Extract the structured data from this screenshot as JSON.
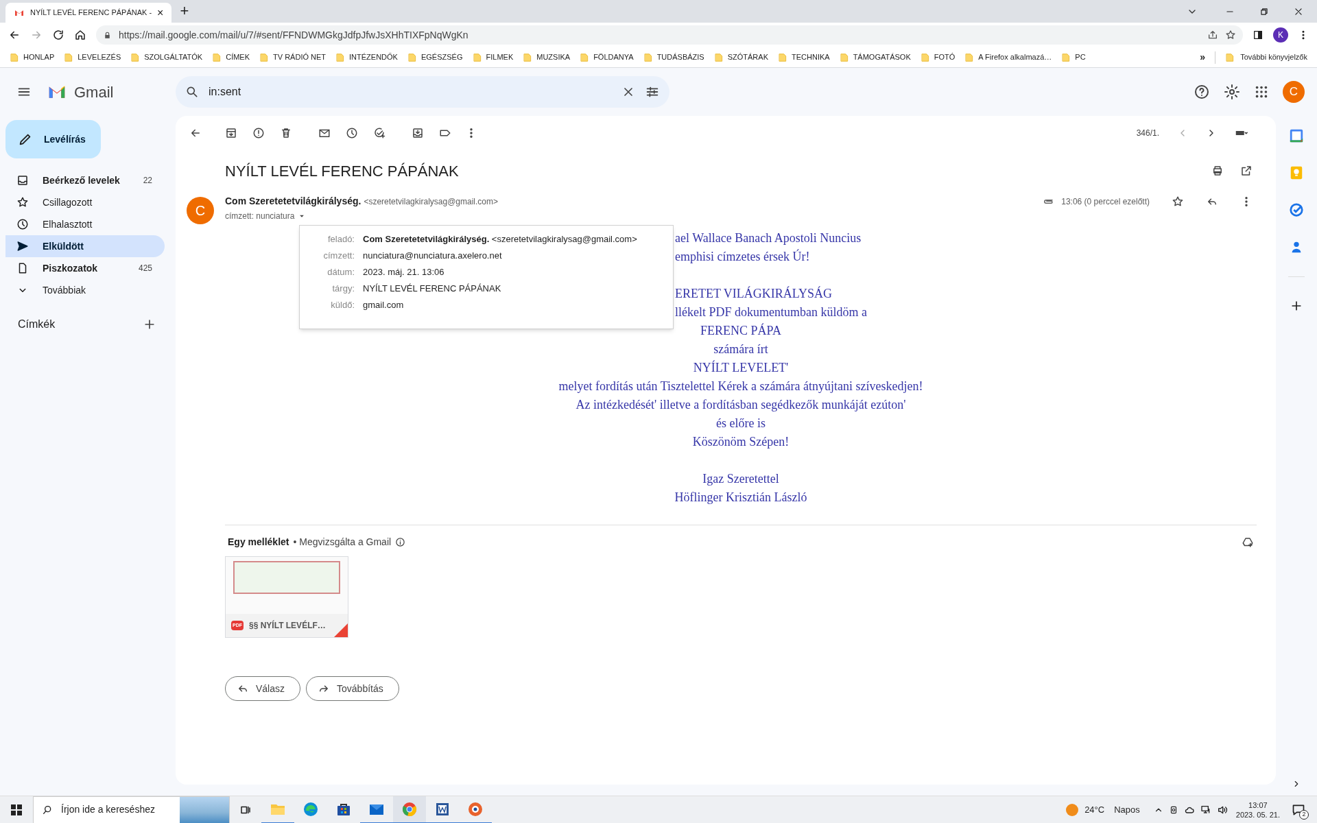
{
  "browser": {
    "tab": {
      "title": "NYÍLT LEVÉL FERENC PÁPÁNAK -",
      "close": "×"
    },
    "new_tab": "+",
    "url": "https://mail.google.com/mail/u/7/#sent/FFNDWMGkgJdfpJfwJsXHhTIXFpNqWgKn",
    "profile": "K",
    "bookmarks": [
      "HONLAP",
      "LEVELEZÉS",
      "SZOLGÁLTATÓK",
      "CÍMEK",
      "TV RÁDIÓ NET",
      "INTÉZENDŐK",
      "EGÉSZSÉG",
      "FILMEK",
      "MUZSIKA",
      "FÖLDANYA",
      "TUDÁSBÁZIS",
      "SZÓTÁRAK",
      "TECHNIKA",
      "TÁMOGATÁSOK",
      "FOTÓ",
      "A Firefox alkalmazá…",
      "PC"
    ],
    "more_bookmarks": "»",
    "other_bookmarks": "További könyvjelzők"
  },
  "gmail": {
    "app": "Gmail",
    "search": {
      "value": "in:sent"
    },
    "avatar": "C",
    "compose": "Levélírás",
    "folders": [
      {
        "kind": "inbox",
        "label": "Beérkező levelek",
        "count": "22",
        "unread": true,
        "selected": false
      },
      {
        "kind": "starred",
        "label": "Csillagozott",
        "unread": false,
        "selected": false
      },
      {
        "kind": "snoozed",
        "label": "Elhalasztott",
        "unread": false,
        "selected": false
      },
      {
        "kind": "sent",
        "label": "Elküldött",
        "unread": true,
        "selected": true
      },
      {
        "kind": "drafts",
        "label": "Piszkozatok",
        "count": "425",
        "unread": true,
        "selected": false
      },
      {
        "kind": "more",
        "label": "Továbbiak",
        "unread": false,
        "selected": false
      }
    ],
    "labels_heading": "Címkék",
    "counter": "346/1.",
    "message": {
      "subject": "NYÍLT LEVÉL FERENC PÁPÁNAK",
      "avatar": "C",
      "sender_name": "Com Szeretetetvilágkirálység.",
      "sender_email": "<szeretetvilagkiralysag@gmail.com>",
      "recipient": "címzett: nunciatura",
      "time": "13:06 (0 perccel ezelőtt)",
      "details": [
        {
          "label": "feladó:",
          "value": "**Com Szeretetetvilágkirálység.** <szeretetvilagkiralysag@gmail.com>"
        },
        {
          "label": "címzett:",
          "value": "nunciatura@nunciatura.axelero.net"
        },
        {
          "label": "dátum:",
          "value": "2023. máj. 21. 13:06"
        },
        {
          "label": "tárgy:",
          "value": "NYÍLT LEVÉL FERENC PÁPÁNAK"
        },
        {
          "label": "küldő:",
          "value": "gmail.com"
        }
      ],
      "body": [
        {
          "kind": "cut",
          "text": "ael Wallace Banach Apostoli Nuncius"
        },
        {
          "kind": "cut",
          "text": "emphisi címzetes érsek Úr!"
        },
        {
          "kind": "blank"
        },
        {
          "kind": "cut",
          "text": "ERETET VILÁGKIRÁLYSÁG"
        },
        {
          "kind": "cut",
          "text": "llékelt PDF dokumentumban küldöm a"
        },
        {
          "kind": "whole",
          "text": "FERENC PÁPA"
        },
        {
          "kind": "whole",
          "text": "számára írt"
        },
        {
          "kind": "whole",
          "text": "NYÍLT LEVELET'"
        },
        {
          "kind": "whole",
          "text": "melyet fordítás után Tisztelettel Kérek a számára átnyújtani szíveskedjen!"
        },
        {
          "kind": "whole",
          "text": "Az intézkedését' illetve a fordításban segédkezők munkáját ezúton'"
        },
        {
          "kind": "whole",
          "text": "és előre is"
        },
        {
          "kind": "whole",
          "text": "Köszönöm Szépen!"
        },
        {
          "kind": "blank"
        },
        {
          "kind": "whole",
          "text": "Igaz Szeretettel"
        },
        {
          "kind": "whole",
          "text": "Höflinger Krisztián László"
        }
      ],
      "attachments": {
        "heading": "Egy melléklet",
        "scan": "• Megvizsgálta a Gmail",
        "files": [
          {
            "badge": "PDF",
            "name": "§§ NYÍLT LEVÉLF…"
          }
        ]
      },
      "actions": [
        {
          "kind": "reply",
          "label": "Válasz"
        },
        {
          "kind": "forward",
          "label": "Továbbítás"
        }
      ]
    }
  },
  "taskbar": {
    "search": {
      "placeholder": "Írjon ide a kereséshez"
    },
    "apps": [
      {
        "kind": "explorer",
        "running": true,
        "active": false
      },
      {
        "kind": "edge",
        "running": false,
        "active": false
      },
      {
        "kind": "store",
        "running": false,
        "active": false
      },
      {
        "kind": "mail",
        "running": true,
        "active": false
      },
      {
        "kind": "chrome",
        "running": true,
        "active": true
      },
      {
        "kind": "word",
        "running": true,
        "active": false
      },
      {
        "kind": "tool",
        "running": true,
        "active": false
      }
    ],
    "weather": {
      "temp": "24°C",
      "condition": "Napos"
    },
    "time": "13:07",
    "date": "2023. 05. 21.",
    "notifications": "2"
  }
}
